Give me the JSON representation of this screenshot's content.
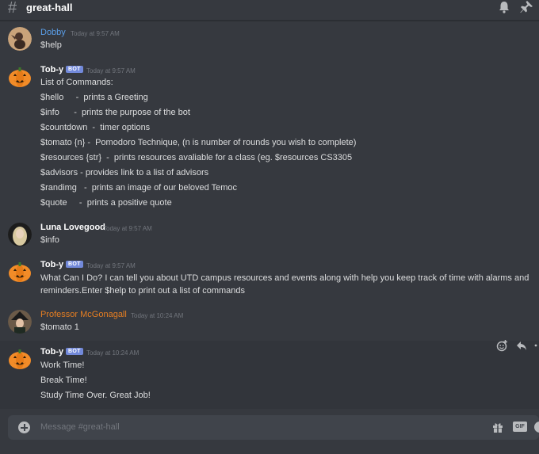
{
  "channel": {
    "hash": "#",
    "name": "great-hall"
  },
  "icons": {
    "bell": "bell-icon",
    "pin": "pin-icon",
    "add_reaction": "add-reaction-icon",
    "reply": "reply-icon",
    "more": "more-icon",
    "attach": "plus-icon",
    "gift": "gift-icon",
    "gif": "GIF",
    "emoji": "emoji-icon"
  },
  "colors": {
    "background": "#36393f",
    "bot_badge": "#7289da",
    "dobby": "#5a9ee8",
    "mcgonagall": "#e67e22",
    "text": "#dcddde",
    "timestamp": "#72767d"
  },
  "messages": [
    {
      "author": "Dobby",
      "time": "Today at 9:57 AM",
      "lines": [
        "$help"
      ]
    },
    {
      "author": "Tob-y",
      "bot": "BOT",
      "time": "Today at 9:57 AM",
      "lines": [
        "List of Commands:",
        "$hello     -  prints a Greeting",
        "$info      -  prints the purpose of the bot",
        "$countdown  -  timer options",
        "$tomato {n} -  Pomodoro Technique, (n is number of rounds you wish to complete)",
        "$resources {str}  -  prints resources avaliable for a class (eg. $resources CS3305",
        "$advisors - provides link to a list of advisors",
        "$randimg   -  prints an image of our beloved Temoc",
        "$quote     -  prints a positive quote"
      ]
    },
    {
      "author": "Luna Lovegood",
      "time": "Today at 9:57 AM",
      "lines": [
        "$info"
      ]
    },
    {
      "author": "Tob-y",
      "bot": "BOT",
      "time": "Today at 9:57 AM",
      "lines": [
        "What Can I Do? I can tell you about UTD campus resources and events along with help you keep track of time with alarms and reminders.Enter $help to print out a list of commands"
      ]
    },
    {
      "author": "Professor McGonagall",
      "time": "Today at 10:24 AM",
      "lines": [
        "$tomato 1"
      ]
    },
    {
      "author": "Tob-y",
      "bot": "BOT",
      "time": "Today at 10:24 AM",
      "lines": [
        "Work Time!",
        "Break Time!",
        "Study Time Over. Great Job!"
      ]
    }
  ],
  "composer": {
    "placeholder": "Message #great-hall"
  }
}
